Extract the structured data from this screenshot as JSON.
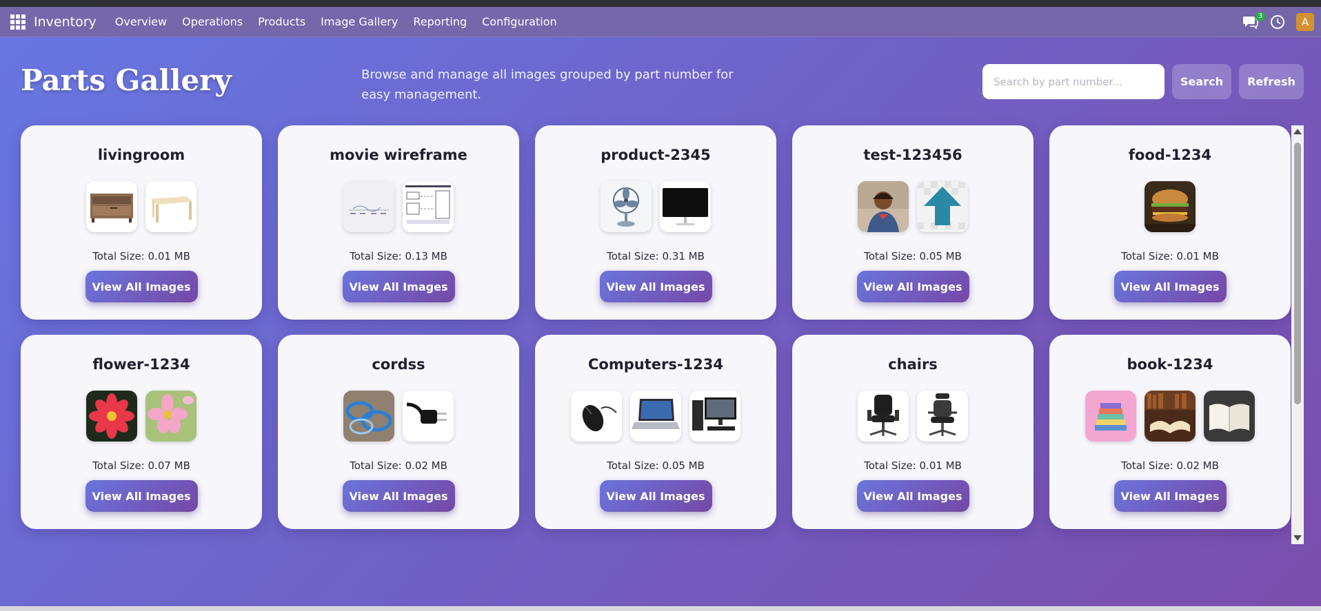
{
  "nav": {
    "app_name": "Inventory",
    "menu": [
      "Overview",
      "Operations",
      "Products",
      "Image Gallery",
      "Reporting",
      "Configuration"
    ],
    "message_count": "3",
    "user_initial": "A"
  },
  "header": {
    "title": "Parts Gallery",
    "description": "Browse and manage all images grouped by part number for easy management.",
    "search_placeholder": "Search by part number...",
    "search_label": "Search",
    "refresh_label": "Refresh"
  },
  "cards": [
    {
      "name": "livingroom",
      "size": "Total Size: 0.01 MB",
      "images": [
        "tv-stand",
        "coffee-table"
      ],
      "button": "View All Images"
    },
    {
      "name": "movie wireframe",
      "size": "Total Size: 0.13 MB",
      "images": [
        "wireframe-sketch",
        "wireframe-diagram"
      ],
      "button": "View All Images"
    },
    {
      "name": "product-2345",
      "size": "Total Size: 0.31 MB",
      "images": [
        "desk-fan",
        "monitor"
      ],
      "button": "View All Images"
    },
    {
      "name": "test-123456",
      "size": "Total Size: 0.05 MB",
      "images": [
        "child-photo",
        "upload-arrow"
      ],
      "button": "View All Images"
    },
    {
      "name": "food-1234",
      "size": "Total Size: 0.01 MB",
      "images": [
        "burger"
      ],
      "button": "View All Images"
    },
    {
      "name": "flower-1234",
      "size": "Total Size: 0.07 MB",
      "images": [
        "red-flower",
        "pink-flower"
      ],
      "button": "View All Images"
    },
    {
      "name": "cordss",
      "size": "Total Size: 0.02 MB",
      "images": [
        "blue-cables",
        "power-plug"
      ],
      "button": "View All Images"
    },
    {
      "name": "Computers-1234",
      "size": "Total Size: 0.05 MB",
      "images": [
        "mouse",
        "laptop",
        "desktop-pc"
      ],
      "button": "View All Images"
    },
    {
      "name": "chairs",
      "size": "Total Size: 0.01 MB",
      "images": [
        "office-chair",
        "mesh-chair"
      ],
      "button": "View All Images"
    },
    {
      "name": "book-1234",
      "size": "Total Size: 0.02 MB",
      "images": [
        "book-stack",
        "open-book-library",
        "open-book"
      ],
      "button": "View All Images"
    }
  ]
}
